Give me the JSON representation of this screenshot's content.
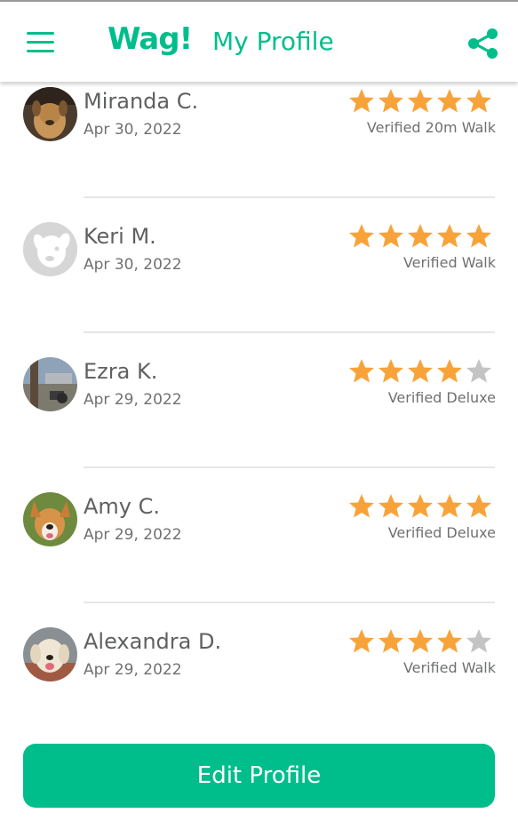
{
  "colors": {
    "brand": "#00bd8c",
    "star_filled": "#f8a33a",
    "star_empty": "#c4c4c4"
  },
  "header": {
    "logo": "Wag!",
    "title": "My Profile",
    "menu_icon": "hamburger-menu-icon",
    "share_icon": "share-icon"
  },
  "reviews": [
    {
      "name": "Miranda C.",
      "date": "Apr 30, 2022",
      "rating": 5,
      "service": "Verified 20m Walk",
      "avatar": "dog-photo"
    },
    {
      "name": "Keri M.",
      "date": "Apr 30, 2022",
      "rating": 5,
      "service": "Verified Walk",
      "avatar": "default-dog-avatar"
    },
    {
      "name": "Ezra K.",
      "date": "Apr 29, 2022",
      "rating": 4,
      "service": "Verified Deluxe",
      "avatar": "dog-photo"
    },
    {
      "name": "Amy C.",
      "date": "Apr 29, 2022",
      "rating": 5,
      "service": "Verified Deluxe",
      "avatar": "dog-photo"
    },
    {
      "name": "Alexandra D.",
      "date": "Apr 29, 2022",
      "rating": 4,
      "service": "Verified Walk",
      "avatar": "dog-photo"
    }
  ],
  "footer": {
    "edit_profile_label": "Edit Profile"
  }
}
